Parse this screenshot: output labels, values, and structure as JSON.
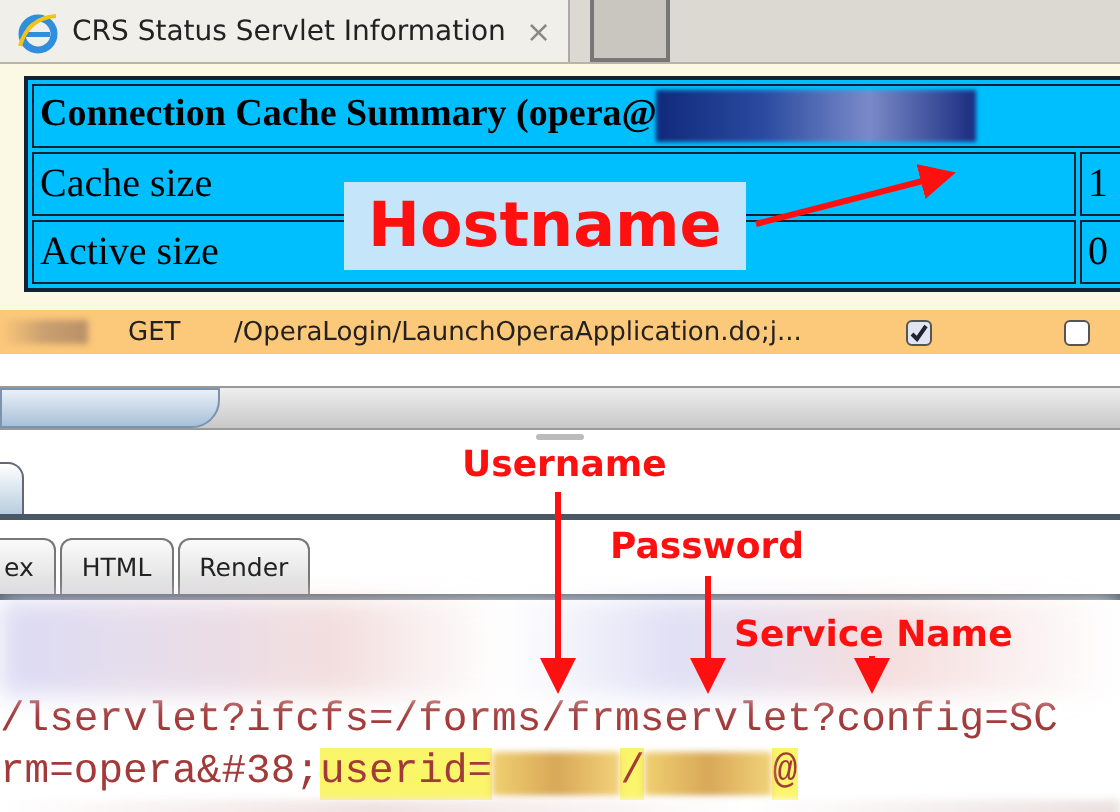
{
  "browser_tab": {
    "title": "CRS Status Servlet Information",
    "close": "×"
  },
  "cache_table": {
    "heading": "Connection Cache Summary (opera@",
    "rows": [
      {
        "label": "Cache size",
        "value": "1"
      },
      {
        "label": "Active size",
        "value": "0"
      }
    ]
  },
  "request_row": {
    "method": "GET",
    "url": "/OperaLogin/LaunchOperaApplication.do;j...",
    "checkboxes": [
      {
        "checked": true
      },
      {
        "checked": false
      }
    ]
  },
  "view_tabs": [
    {
      "label": "ex",
      "selected": false
    },
    {
      "label": "HTML",
      "selected": false
    },
    {
      "label": "Render",
      "selected": false
    }
  ],
  "code_lines": [
    {
      "parts": [
        {
          "kind": "text",
          "text": "/lservlet?ifcfs=/forms/frmservlet?config=SC",
          "highlight": false
        }
      ]
    },
    {
      "parts": [
        {
          "kind": "text",
          "text": "rm=opera&#38;",
          "highlight": false
        },
        {
          "kind": "text",
          "text": "userid=",
          "highlight": true
        },
        {
          "kind": "redacted",
          "highlight": true
        },
        {
          "kind": "text",
          "text": "/",
          "highlight": true
        },
        {
          "kind": "redacted",
          "highlight": true
        },
        {
          "kind": "text",
          "text": "@",
          "highlight": true
        }
      ]
    }
  ],
  "annotations": [
    {
      "label": "Hostname"
    },
    {
      "label": "Username"
    },
    {
      "label": "Password"
    },
    {
      "label": "Service Name"
    }
  ]
}
